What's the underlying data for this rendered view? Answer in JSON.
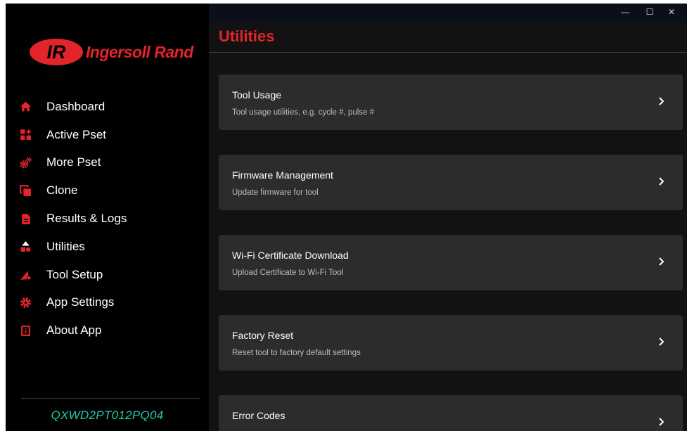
{
  "window": {
    "controls": {
      "minimize": "—",
      "maximize": "☐",
      "close": "✕"
    }
  },
  "brand": {
    "logo_mark": "IR",
    "name": "Ingersoll Rand",
    "color": "#e3242b"
  },
  "sidebar": {
    "items": [
      {
        "label": "Dashboard",
        "icon": "home-icon"
      },
      {
        "label": "Active Pset",
        "icon": "active-pset-icon"
      },
      {
        "label": "More Pset",
        "icon": "gears-icon"
      },
      {
        "label": "Clone",
        "icon": "clone-icon"
      },
      {
        "label": "Results & Logs",
        "icon": "document-icon"
      },
      {
        "label": "Utilities",
        "icon": "shapes-icon"
      },
      {
        "label": "Tool Setup",
        "icon": "tool-setup-icon"
      },
      {
        "label": "App Settings",
        "icon": "gear-icon"
      },
      {
        "label": "About App",
        "icon": "info-icon"
      }
    ],
    "icon_color": "#e3242b",
    "serial": "QXWD2PT012PQ04",
    "serial_color": "#26c6a8"
  },
  "main": {
    "title": "Utilities",
    "cards": [
      {
        "title": "Tool Usage",
        "subtitle": "Tool usage utilities, e.g. cycle #, pulse #"
      },
      {
        "title": "Firmware Management",
        "subtitle": "Update firmware for tool"
      },
      {
        "title": "Wi-Fi Certificate Download",
        "subtitle": "Upload Certificate to Wi-Fi Tool"
      },
      {
        "title": "Factory Reset",
        "subtitle": "Reset tool to factory default settings"
      },
      {
        "title": "Error Codes",
        "subtitle": ""
      }
    ]
  }
}
